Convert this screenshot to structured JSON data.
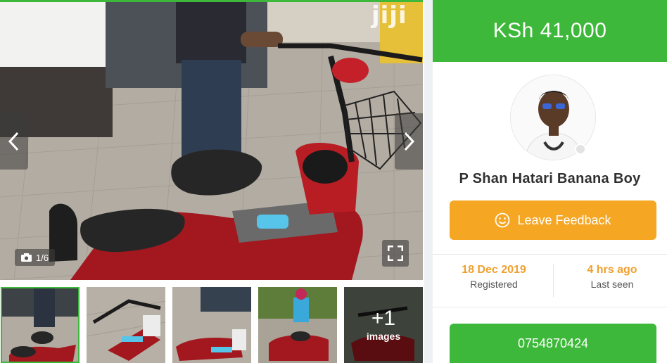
{
  "gallery": {
    "counter": "1/6",
    "watermark": "jiji",
    "more_count": "+1",
    "more_label": "images"
  },
  "listing": {
    "price": "KSh 41,000"
  },
  "seller": {
    "name": "P Shan Hatari Banana Boy",
    "feedback_label": "Leave Feedback",
    "registered_value": "18 Dec 2019",
    "registered_label": "Registered",
    "last_seen_value": "4 hrs ago",
    "last_seen_label": "Last seen",
    "phone": "0754870424"
  },
  "colors": {
    "brand_green": "#3db83a",
    "accent_orange": "#f5a623",
    "stat_orange": "#f0a030"
  },
  "icons": [
    "chevron-left-icon",
    "chevron-right-icon",
    "camera-icon",
    "fullscreen-icon",
    "smiley-icon"
  ]
}
